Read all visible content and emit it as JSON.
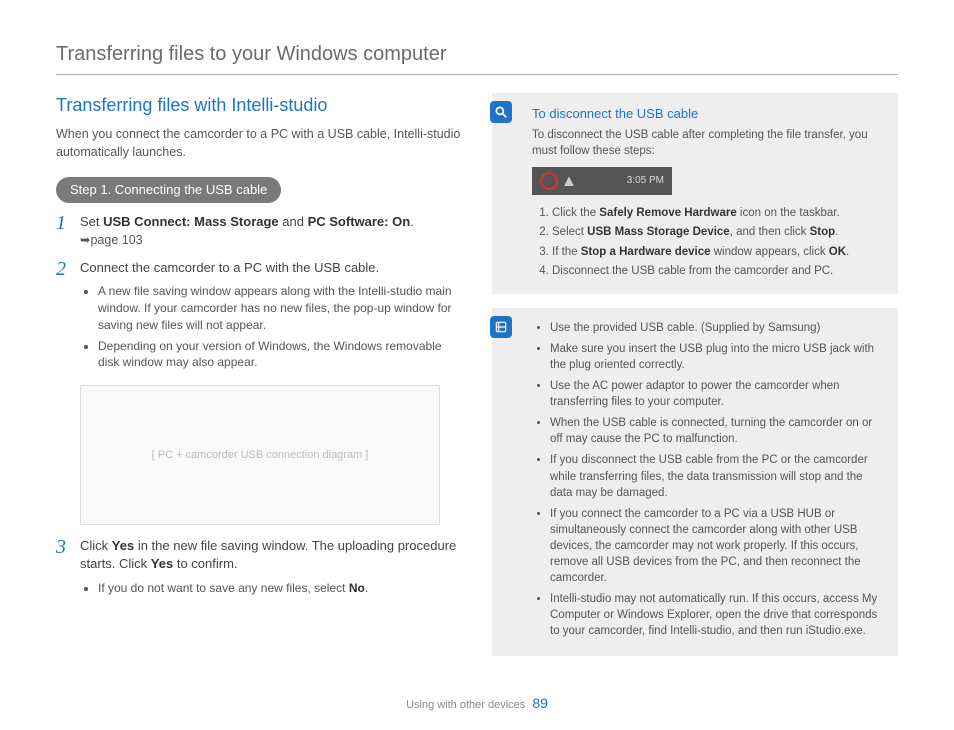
{
  "page_title": "Transferring files to your Windows computer",
  "section_title": "Transferring files with Intelli-studio",
  "intro": "When you connect the camcorder to a PC with a USB cable, Intelli-studio automatically launches.",
  "step1_label": "Step 1. Connecting the USB cable",
  "item1": {
    "num": "1",
    "pre": "Set ",
    "b1": "USB Connect: Mass Storage",
    "mid": " and ",
    "b2": "PC Software: On",
    "post": ".",
    "ref": "➥page 103"
  },
  "item2": {
    "num": "2",
    "text": "Connect the camcorder to a PC with the USB cable.",
    "bullets": [
      "A new file saving window appears along with the Intelli-studio main window. If your camcorder has no new files, the pop-up window for saving new files will not appear.",
      "Depending on your version of Windows, the Windows removable disk window may also appear."
    ]
  },
  "illust_alt": "[ PC + camcorder USB connection diagram ]",
  "item3": {
    "num": "3",
    "pre": "Click ",
    "b1": "Yes",
    "mid": " in the new file saving window. The uploading procedure starts. Click ",
    "b2": "Yes",
    "post": " to confirm.",
    "bullet_pre": "If you do not want to save any new files, select ",
    "bullet_b": "No",
    "bullet_post": "."
  },
  "box1": {
    "title": "To disconnect the USB cable",
    "intro": "To disconnect the USB cable after completing the file transfer, you must follow these steps:",
    "time": "3:05 PM",
    "steps": [
      {
        "pre": "Click the ",
        "b": "Safely Remove Hardware",
        "post": " icon on the taskbar."
      },
      {
        "pre": "Select ",
        "b": "USB Mass Storage Device",
        "post": ", and then click ",
        "b2": "Stop",
        "post2": "."
      },
      {
        "pre": "If the ",
        "b": "Stop a Hardware device",
        "post": " window appears, click ",
        "b2": "OK",
        "post2": "."
      },
      {
        "pre": "Disconnect the USB cable from the camcorder and PC.",
        "b": "",
        "post": ""
      }
    ]
  },
  "box2": {
    "bullets": [
      "Use the provided USB cable. (Supplied by Samsung)",
      "Make sure you insert the USB plug into the micro USB jack with the plug oriented correctly.",
      "Use the AC power adaptor to power the camcorder when transferring files to your computer.",
      "When the USB cable is connected, turning the camcorder on or off may cause the PC to malfunction.",
      "If you disconnect the USB cable from the PC or the camcorder while transferring files, the data transmission will stop and the data may be damaged.",
      "If you connect the camcorder to a PC via a USB HUB or simultaneously connect the camcorder along with other USB devices, the camcorder may not work properly. If this occurs, remove all USB devices from the PC, and then reconnect the camcorder.",
      "Intelli-studio may not automatically run. If this occurs, access My Computer or Windows Explorer, open the drive that corresponds to your camcorder, find Intelli-studio, and then run iStudio.exe."
    ]
  },
  "footer_text": "Using with other devices",
  "page_number": "89"
}
